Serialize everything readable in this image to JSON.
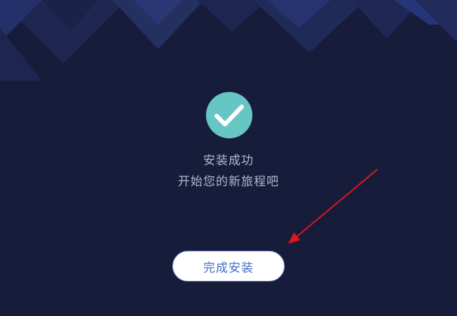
{
  "message": {
    "title": "安装成功",
    "subtitle": "开始您的新旅程吧"
  },
  "actions": {
    "finish_label": "完成安装"
  },
  "icons": {
    "status": "check-circle-icon"
  },
  "colors": {
    "background": "#171c3a",
    "accent_teal": "#66c6c4",
    "button_text": "#3f6fc4",
    "annotation_arrow": "#e0161b"
  }
}
